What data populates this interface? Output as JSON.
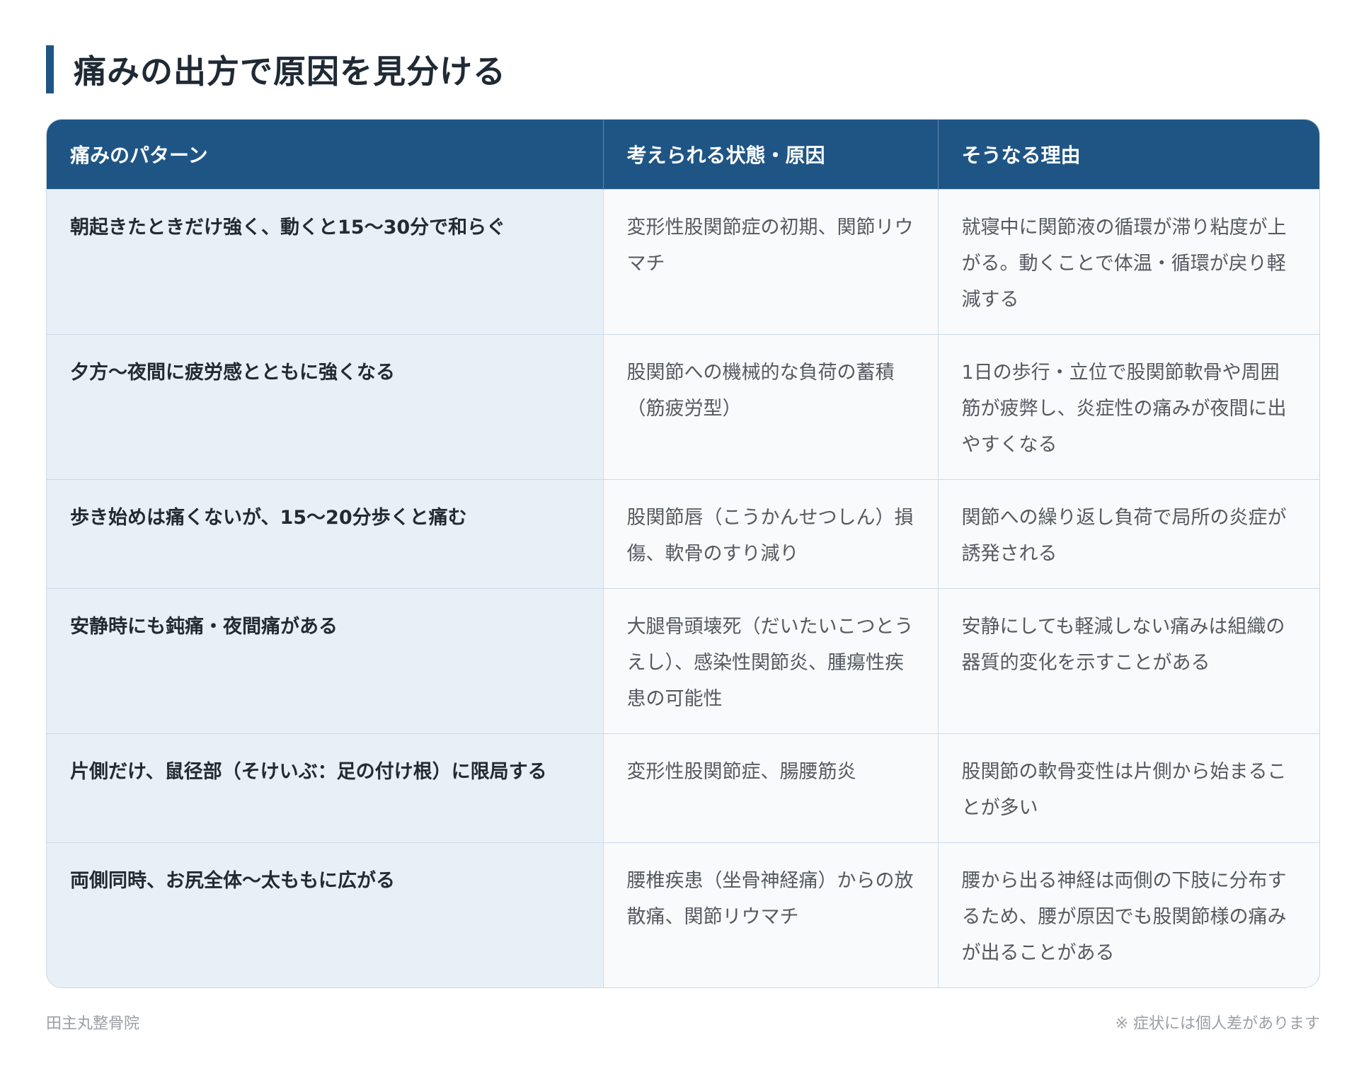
{
  "title": "痛みの出方で原因を見分ける",
  "table": {
    "headers": [
      "痛みのパターン",
      "考えられる状態・原因",
      "そうなる理由"
    ],
    "rows": [
      {
        "pattern": "朝起きたときだけ強く、動くと15〜30分で和らぐ",
        "cause": "変形性股関節症の初期、関節リウマチ",
        "reason": "就寝中に関節液の循環が滞り粘度が上がる。動くことで体温・循環が戻り軽減する"
      },
      {
        "pattern": "夕方〜夜間に疲労感とともに強くなる",
        "cause": "股関節への機械的な負荷の蓄積（筋疲労型）",
        "reason": "1日の歩行・立位で股関節軟骨や周囲筋が疲弊し、炎症性の痛みが夜間に出やすくなる"
      },
      {
        "pattern": "歩き始めは痛くないが、15〜20分歩くと痛む",
        "cause": "股関節唇（こうかんせつしん）損傷、軟骨のすり減り",
        "reason": "関節への繰り返し負荷で局所の炎症が誘発される"
      },
      {
        "pattern": "安静時にも鈍痛・夜間痛がある",
        "cause": "大腿骨頭壊死（だいたいこつとうえし）、感染性関節炎、腫瘍性疾患の可能性",
        "reason": "安静にしても軽減しない痛みは組織の器質的変化を示すことがある"
      },
      {
        "pattern": "片側だけ、鼠径部（そけいぶ：足の付け根）に限局する",
        "cause": "変形性股関節症、腸腰筋炎",
        "reason": "股関節の軟骨変性は片側から始まることが多い"
      },
      {
        "pattern": "両側同時、お尻全体〜太ももに広がる",
        "cause": "腰椎疾患（坐骨神経痛）からの放散痛、関節リウマチ",
        "reason": "腰から出る神経は両側の下肢に分布するため、腰が原因でも股関節様の痛みが出ることがある"
      }
    ]
  },
  "footer": {
    "left": "田主丸整骨院",
    "right": "※ 症状には個人差があります"
  }
}
